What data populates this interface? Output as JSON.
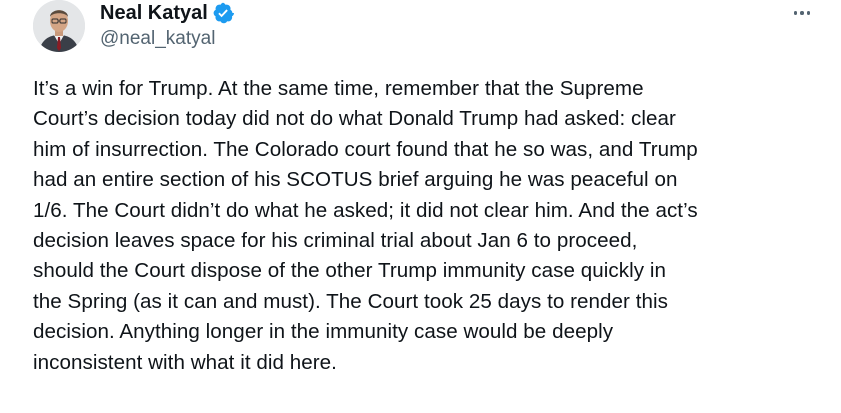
{
  "author": {
    "display_name": "Neal Katyal",
    "handle": "@neal_katyal",
    "verified": true,
    "avatar_icon": "person-avatar",
    "verified_icon": "verified-badge-icon",
    "verified_color": "#1d9bf0"
  },
  "menu": {
    "more_icon": "more-options-icon"
  },
  "tweet": {
    "text": "It’s a win for Trump. At the same time, remember that the Supreme\nCourt’s decision today did not do what Donald Trump had asked: clear\nhim of insurrection. The Colorado court found that he so was, and Trump\nhad an entire section of his SCOTUS brief arguing he was peaceful on\n1/6. The Court didn’t do what he asked; it did not clear him. And the act’s\ndecision leaves space for his criminal trial about Jan 6 to proceed,\nshould the Court dispose of the other Trump immunity case quickly in\nthe Spring (as it can and must). The Court took 25 days to render this\ndecision. Anything longer in the immunity case would be deeply\ninconsistent with what it did here."
  },
  "colors": {
    "text_primary": "#0f1419",
    "text_secondary": "#536471",
    "background": "#ffffff"
  }
}
